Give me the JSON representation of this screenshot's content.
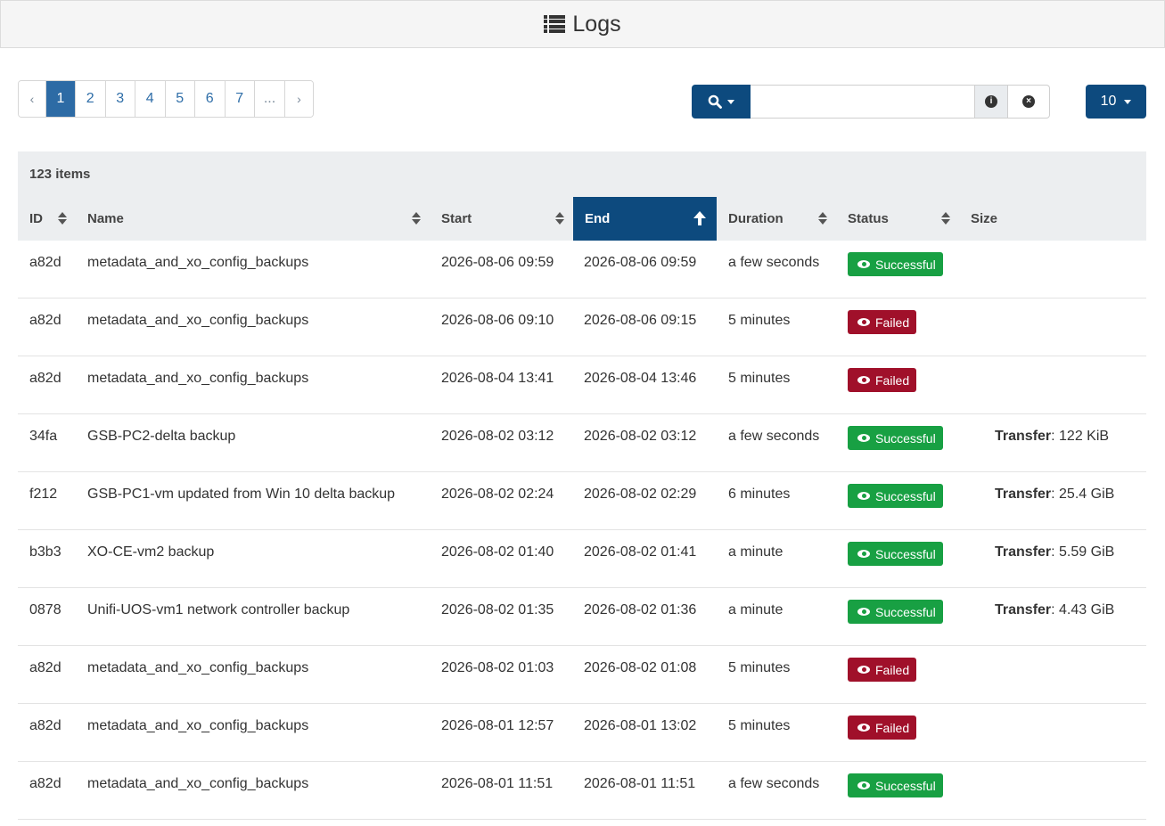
{
  "header": {
    "title": "Logs",
    "icon": "list-icon"
  },
  "pagination": {
    "prev": "‹",
    "pages": [
      "1",
      "2",
      "3",
      "4",
      "5",
      "6",
      "7"
    ],
    "active": "1",
    "ellipsis": "...",
    "next": "›"
  },
  "search": {
    "value": "",
    "placeholder": ""
  },
  "per_page": {
    "value": "10"
  },
  "table": {
    "item_count": "123 items",
    "columns": {
      "id": "ID",
      "name": "Name",
      "start": "Start",
      "end": "End",
      "duration": "Duration",
      "status": "Status",
      "size": "Size"
    },
    "sorted_column": "End",
    "rows": [
      {
        "id": "a82d",
        "name": "metadata_and_xo_config_backups",
        "start": "2026-08-06 09:59",
        "end": "2026-08-06 09:59",
        "duration": "a few seconds",
        "status": "Successful",
        "status_kind": "ok",
        "size_label": "",
        "size_value": ""
      },
      {
        "id": "a82d",
        "name": "metadata_and_xo_config_backups",
        "start": "2026-08-06 09:10",
        "end": "2026-08-06 09:15",
        "duration": "5 minutes",
        "status": "Failed",
        "status_kind": "fail",
        "size_label": "",
        "size_value": ""
      },
      {
        "id": "a82d",
        "name": "metadata_and_xo_config_backups",
        "start": "2026-08-04 13:41",
        "end": "2026-08-04 13:46",
        "duration": "5 minutes",
        "status": "Failed",
        "status_kind": "fail",
        "size_label": "",
        "size_value": ""
      },
      {
        "id": "34fa",
        "name": "GSB-PC2-delta backup",
        "start": "2026-08-02 03:12",
        "end": "2026-08-02 03:12",
        "duration": "a few seconds",
        "status": "Successful",
        "status_kind": "ok",
        "size_label": "Transfer",
        "size_value": ": 122 KiB"
      },
      {
        "id": "f212",
        "name": "GSB-PC1-vm updated from Win 10 delta backup",
        "start": "2026-08-02 02:24",
        "end": "2026-08-02 02:29",
        "duration": "6 minutes",
        "status": "Successful",
        "status_kind": "ok",
        "size_label": "Transfer",
        "size_value": ": 25.4 GiB"
      },
      {
        "id": "b3b3",
        "name": "XO-CE-vm2 backup",
        "start": "2026-08-02 01:40",
        "end": "2026-08-02 01:41",
        "duration": "a minute",
        "status": "Successful",
        "status_kind": "ok",
        "size_label": "Transfer",
        "size_value": ": 5.59 GiB"
      },
      {
        "id": "0878",
        "name": "Unifi-UOS-vm1 network controller backup",
        "start": "2026-08-02 01:35",
        "end": "2026-08-02 01:36",
        "duration": "a minute",
        "status": "Successful",
        "status_kind": "ok",
        "size_label": "Transfer",
        "size_value": ": 4.43 GiB"
      },
      {
        "id": "a82d",
        "name": "metadata_and_xo_config_backups",
        "start": "2026-08-02 01:03",
        "end": "2026-08-02 01:08",
        "duration": "5 minutes",
        "status": "Failed",
        "status_kind": "fail",
        "size_label": "",
        "size_value": ""
      },
      {
        "id": "a82d",
        "name": "metadata_and_xo_config_backups",
        "start": "2026-08-01 12:57",
        "end": "2026-08-01 13:02",
        "duration": "5 minutes",
        "status": "Failed",
        "status_kind": "fail",
        "size_label": "",
        "size_value": ""
      },
      {
        "id": "a82d",
        "name": "metadata_and_xo_config_backups",
        "start": "2026-08-01 11:51",
        "end": "2026-08-01 11:51",
        "duration": "a few seconds",
        "status": "Successful",
        "status_kind": "ok",
        "size_label": "",
        "size_value": ""
      }
    ]
  },
  "colors": {
    "primary": "#0d4a7e",
    "active_page": "#2d6ba5",
    "success": "#18a043",
    "failed": "#a0102a"
  }
}
